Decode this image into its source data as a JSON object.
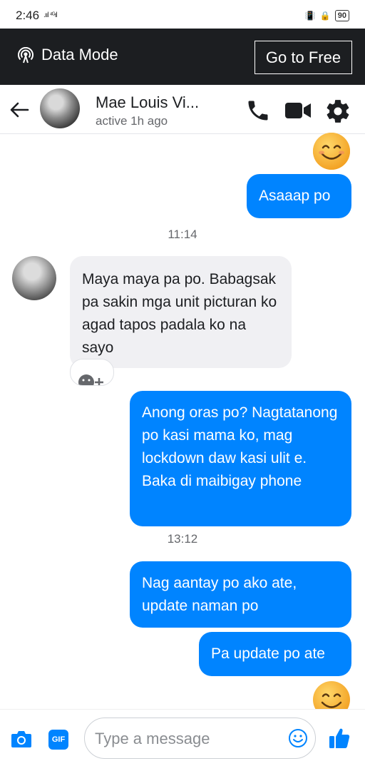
{
  "status_bar": {
    "time": "2:46",
    "signal": ".ııl ⁴ᴳıl",
    "battery": "90"
  },
  "banner": {
    "label": "Data Mode",
    "button": "Go to Free"
  },
  "header": {
    "contact_name": "Mae Louis Vi...",
    "status": "active 1h ago"
  },
  "messages": [
    {
      "type": "emoji",
      "from": "me",
      "emoji": "😊"
    },
    {
      "type": "text",
      "from": "me",
      "text": "Asaaap po"
    },
    {
      "type": "timestamp",
      "text": "11:14"
    },
    {
      "type": "text",
      "from": "contact",
      "text": "Maya maya pa po. Babagsak pa sakin mga unit picturan ko agad tapos padala ko na sayo"
    },
    {
      "type": "text",
      "from": "me",
      "text": "Anong oras po? Nagtatanong po kasi mama ko, mag lockdown daw kasi ulit e. Baka di maibigay phone"
    },
    {
      "type": "timestamp",
      "text": "13:12"
    },
    {
      "type": "text",
      "from": "me",
      "text": "Nag aantay po ako ate, update naman po"
    },
    {
      "type": "text",
      "from": "me",
      "text": "Pa update po ate"
    },
    {
      "type": "emoji",
      "from": "me",
      "emoji": "😊"
    }
  ],
  "composer": {
    "placeholder": "Type a message",
    "gif_label": "GIF"
  },
  "colors": {
    "accent": "#0084ff",
    "banner_bg": "#1c1e21",
    "incoming_bg": "#f0f0f3"
  }
}
